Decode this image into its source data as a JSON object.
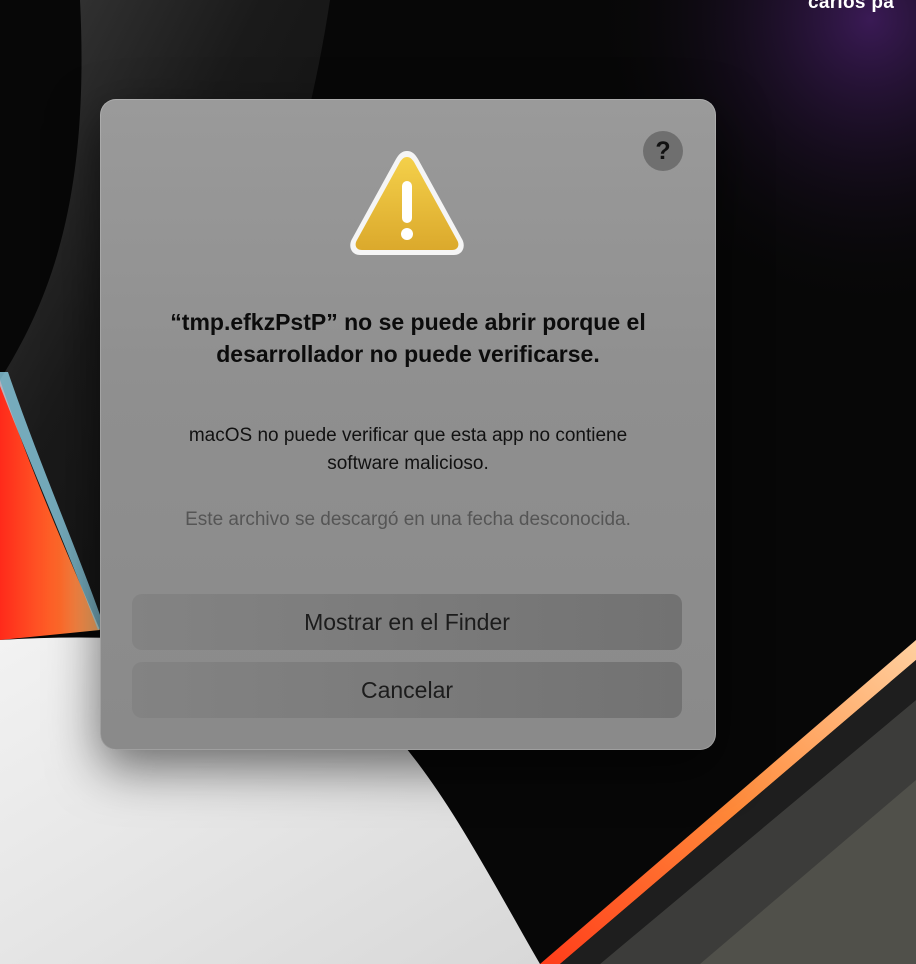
{
  "desktop": {
    "user_name": "carlos pa"
  },
  "dialog": {
    "help_label": "?",
    "icon": "warning-triangle-icon",
    "title": "“tmp.efkzPstP” no se puede abrir porque el desarrollador no puede verificarse.",
    "message": "macOS no puede verificar que esta app no contiene software malicioso.",
    "info": "Este archivo se descargó en una fecha desconocida.",
    "buttons": {
      "show_in_finder": "Mostrar en el Finder",
      "cancel": "Cancelar"
    }
  },
  "colors": {
    "warning_fill": "#e8b93a",
    "dialog_background": "#949494",
    "button_background": "#7b7b7b"
  }
}
